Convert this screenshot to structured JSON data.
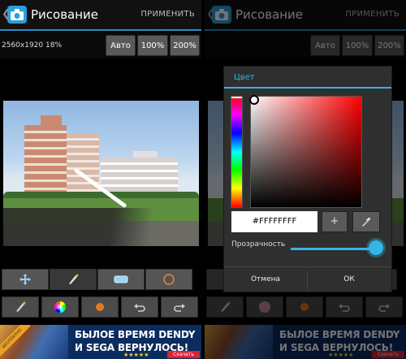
{
  "app": {
    "title": "Рисование",
    "apply_label": "ПРИМЕНИТЬ",
    "back_icon": "chevron-left-icon",
    "app_icon": "camera-icon"
  },
  "zoom": {
    "info": "2560x1920 18%",
    "buttons": [
      "Авто",
      "100%",
      "200%"
    ]
  },
  "tools_row1": [
    {
      "name": "move-icon",
      "selected": false
    },
    {
      "name": "brush-icon",
      "selected": true
    },
    {
      "name": "eraser-icon",
      "selected": false
    },
    {
      "name": "circle-icon",
      "selected": false
    }
  ],
  "tools_row2": [
    {
      "name": "brush-size-icon"
    },
    {
      "name": "color-wheel-icon"
    },
    {
      "name": "brush-dot-icon"
    },
    {
      "name": "undo-icon"
    },
    {
      "name": "redo-icon"
    }
  ],
  "ad": {
    "ribbon": "БЕСПЛАТНО",
    "line1": "БЫЛОЕ ВРЕМЯ DENDY",
    "line2": "И SEGA ВЕРНУЛОСЬ!",
    "stars": "★★★★★",
    "download": "Скачать"
  },
  "dialog": {
    "title": "Цвет",
    "hex": "#FFFFFFFF",
    "plus_label": "+",
    "opacity_label": "Прозрачность",
    "opacity": 1.0,
    "cancel_label": "Отмена",
    "ok_label": "ОК"
  },
  "colors": {
    "accent": "#33b5e5",
    "button": "#5a5a5a",
    "background": "#000000"
  }
}
